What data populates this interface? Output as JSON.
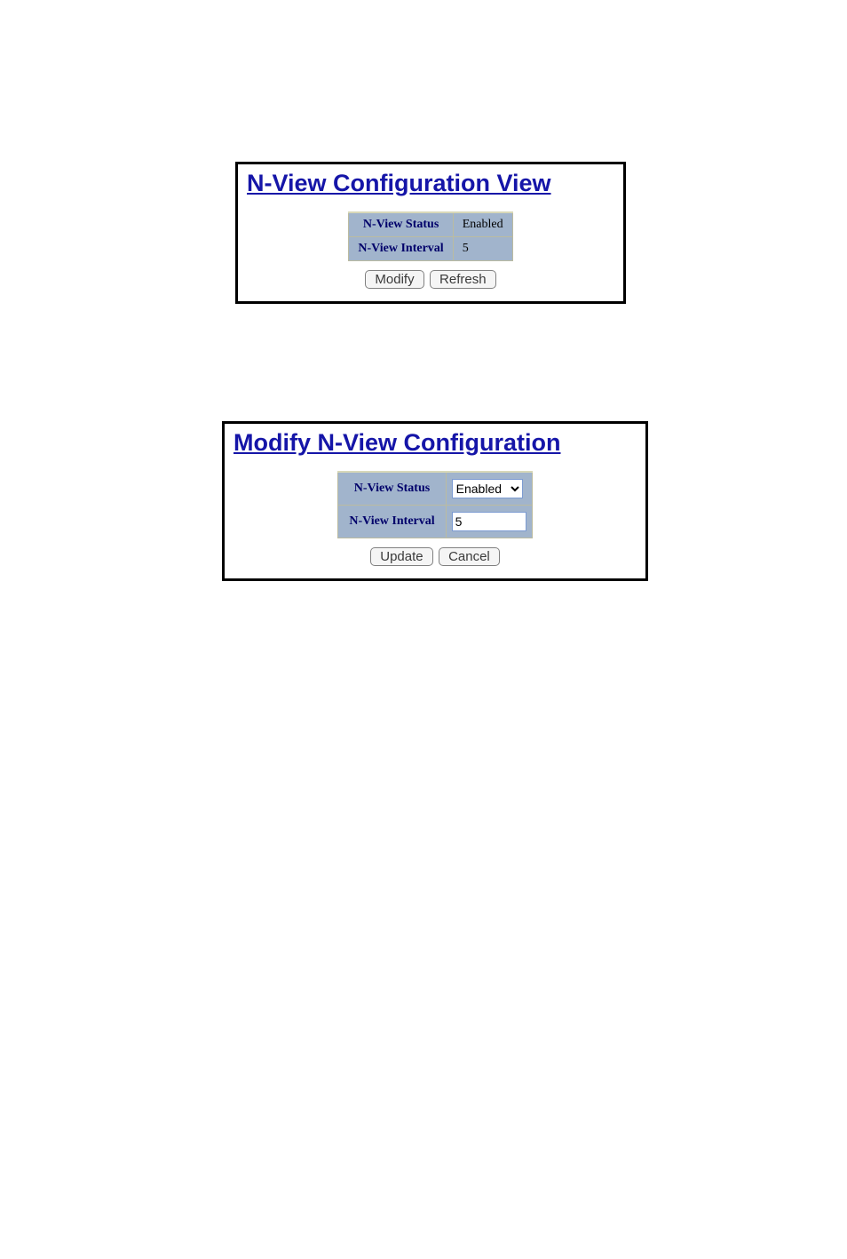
{
  "view": {
    "title": "N-View Configuration View",
    "rows": [
      {
        "label": "N-View Status",
        "value": "Enabled"
      },
      {
        "label": "N-View Interval",
        "value": "5"
      }
    ],
    "buttons": {
      "modify": "Modify",
      "refresh": "Refresh"
    }
  },
  "modify": {
    "title": "Modify N-View Configuration",
    "rows": [
      {
        "label": "N-View Status"
      },
      {
        "label": "N-View Interval"
      }
    ],
    "status_selected": "Enabled",
    "interval_value": "5",
    "buttons": {
      "update": "Update",
      "cancel": "Cancel"
    }
  }
}
